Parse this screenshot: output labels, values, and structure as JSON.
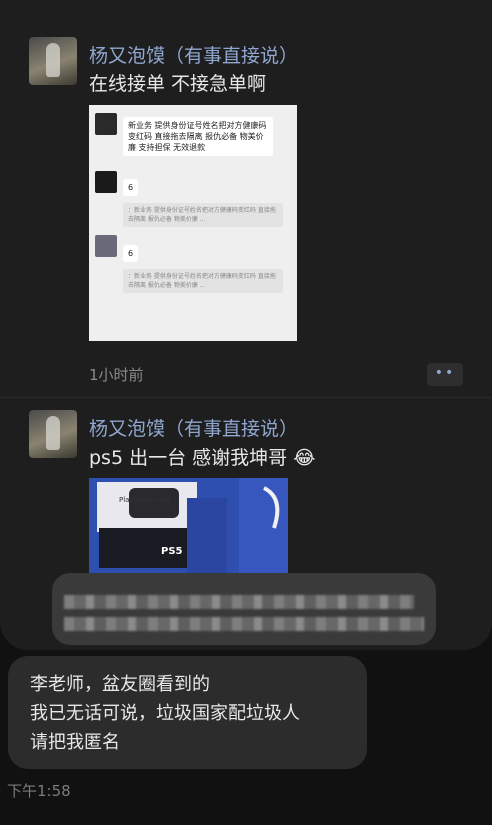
{
  "posts": [
    {
      "author": "杨又泡馍（有事直接说）",
      "text": "在线接单 不接急单啊",
      "time_ago": "1小时前",
      "screenshot": {
        "message": "新业务 提供身份证号姓名把对方健康码变红码 直接拖去隔离 报仇必备 物美价廉 支持担保 无效退款",
        "reply_1": "6",
        "quote_1": "：新业务 提供身份证号姓名把对方健康码变红码 直接拖去隔离 报仇必备 物美价廉 ...",
        "reply_2": "6",
        "quote_2": "：新业务 提供身份证号姓名把对方健康码变红码 直接拖去隔离 报仇必备 物美价廉 ..."
      }
    },
    {
      "author": "杨又泡馍（有事直接说）",
      "text": "ps5 出一台 感谢我坤哥",
      "emoji": "😂",
      "photo": {
        "box_label": "PlayStation VR",
        "brand_label": "PS5"
      }
    }
  ],
  "more_button": "••",
  "chat": {
    "lines": [
      "李老师，盆友圈看到的",
      "我已无话可说，垃圾国家配垃圾人",
      "请把我匿名"
    ],
    "time": "下午1:58"
  },
  "colors": {
    "author_name": "#8fa6cf",
    "card_bg": "#1e1e1e",
    "page_bg": "#111111",
    "bubble_bg": "#2c2c2c"
  }
}
